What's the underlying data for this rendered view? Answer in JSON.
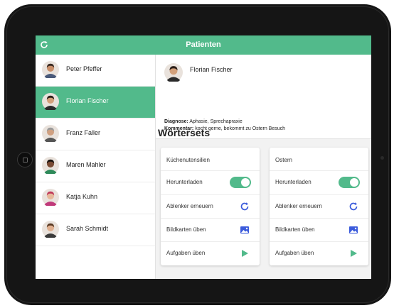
{
  "header": {
    "title": "Patienten"
  },
  "patients": [
    {
      "name": "Peter Pfeffer",
      "avatar_color": "#c98f6a",
      "hair": "#3a2a22",
      "shirt": "#4a5a7a"
    },
    {
      "name": "Florian Fischer",
      "avatar_color": "#d3a07a",
      "hair": "#2b1e18",
      "shirt": "#2a2a2a"
    },
    {
      "name": "Franz Faller",
      "avatar_color": "#d0a080",
      "hair": "#9a9a9a",
      "shirt": "#555"
    },
    {
      "name": "Maren Mahler",
      "avatar_color": "#7a4b34",
      "hair": "#1b1410",
      "shirt": "#2e8a5a"
    },
    {
      "name": "Katja Kuhn",
      "avatar_color": "#e7b89a",
      "hair": "#c03a5a",
      "shirt": "#c03a7a"
    },
    {
      "name": "Sarah Schmidt",
      "avatar_color": "#e0b090",
      "hair": "#5a3a24",
      "shirt": "#3a3a3a"
    }
  ],
  "selected_index": 1,
  "detail": {
    "name": "Florian Fischer",
    "diagnosis_label": "Diagnose:",
    "diagnosis_value": "Aphasie, Sprechapraxie",
    "comment_label": "Kommentar:",
    "comment_value": "kocht gerne, bekommt zu Ostern Besuch"
  },
  "wordsets_title": "Wörtersets",
  "wordsets": [
    {
      "name": "Küchenutensilien",
      "download_label": "Herunterladen",
      "download_on": true,
      "distractor_label": "Ablenker erneuern",
      "picture_label": "Bildkarten üben",
      "tasks_label": "Aufgaben üben"
    },
    {
      "name": "Ostern",
      "download_label": "Herunterladen",
      "download_on": true,
      "distractor_label": "Ablenker erneuern",
      "picture_label": "Bildkarten üben",
      "tasks_label": "Aufgaben üben"
    }
  ],
  "colors": {
    "accent": "#52ba8b",
    "icon_blue": "#3b5bdb"
  },
  "icons": {
    "refresh": "refresh-icon",
    "reload": "reload-icon",
    "image": "image-icon",
    "play": "play-icon"
  }
}
